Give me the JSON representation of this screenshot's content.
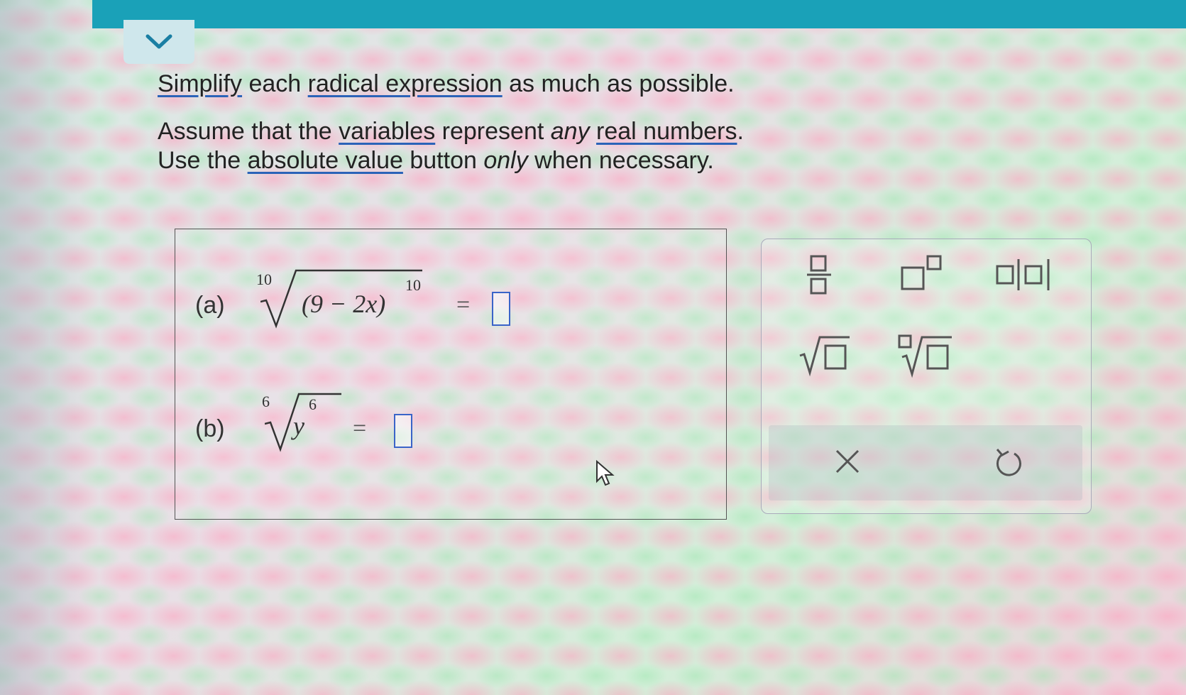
{
  "instructions": {
    "line1": [
      "Simplify",
      " each ",
      "radical expression",
      " as much as possible."
    ],
    "line2": [
      "Assume that the ",
      "variables",
      " represent ",
      "any",
      " ",
      "real numbers",
      "."
    ],
    "line3": [
      "Use the ",
      "absolute value",
      " button ",
      "only",
      " when necessary."
    ]
  },
  "problems": {
    "a": {
      "label": "(a)",
      "index": "10",
      "base": "(9 − 2x)",
      "exponent": "10",
      "equals": "=",
      "answer": ""
    },
    "b": {
      "label": "(b)",
      "index": "6",
      "base": "y",
      "exponent": "6",
      "equals": "=",
      "answer": ""
    }
  },
  "toolbar": {
    "tools": [
      "fraction-icon",
      "superscript-icon",
      "absolute-value-icon",
      "square-root-icon",
      "nth-root-icon",
      "clear-icon",
      "undo-icon"
    ],
    "accent_color": "#3a64c8",
    "topbar_color": "#1aa1b8"
  }
}
